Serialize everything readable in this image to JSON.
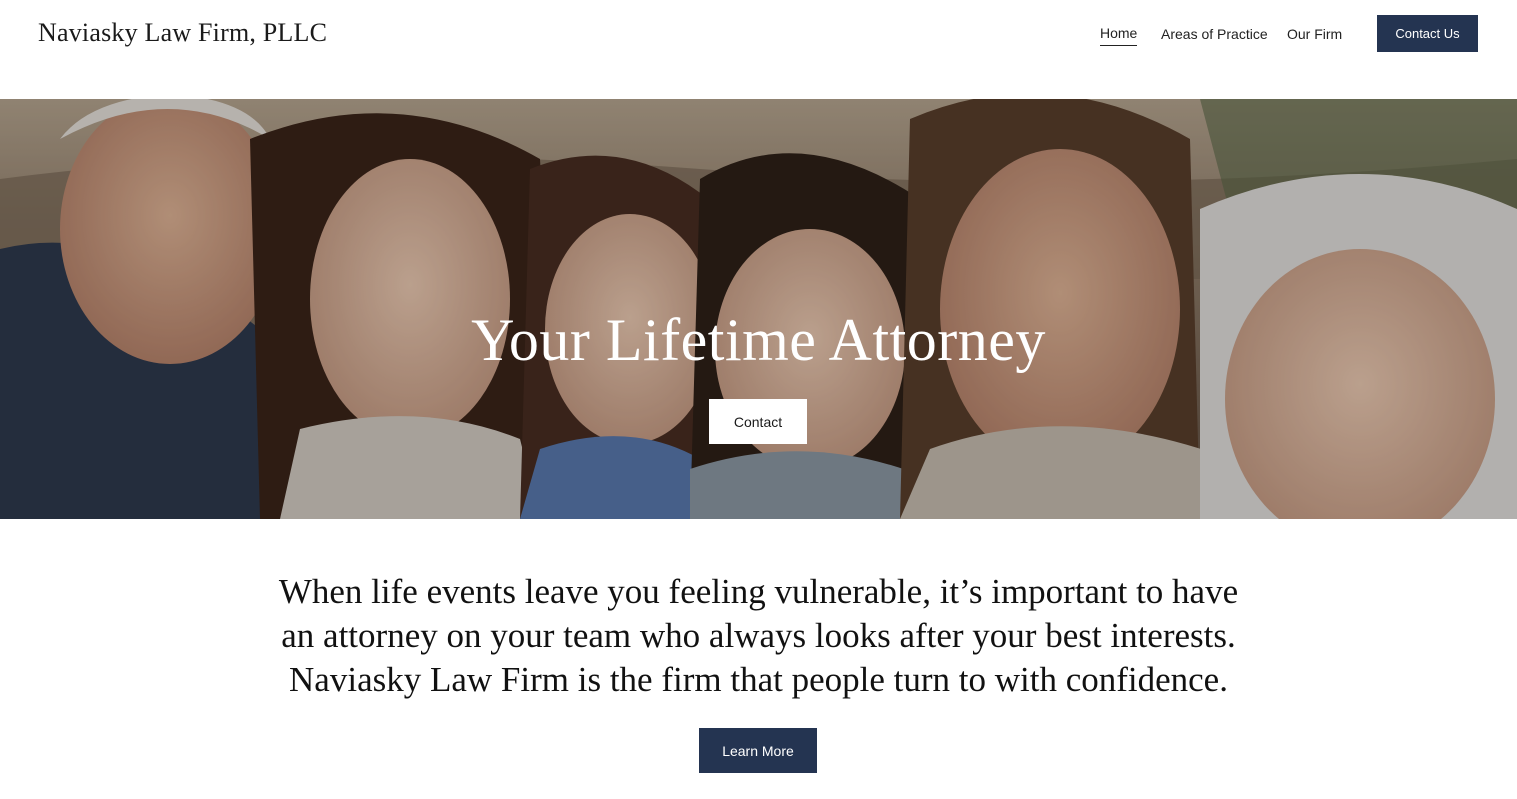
{
  "header": {
    "logo": "Naviasky Law Firm, PLLC",
    "nav": [
      {
        "label": "Home"
      },
      {
        "label": "Areas of Practice"
      },
      {
        "label": "Our Firm"
      }
    ],
    "cta_label": "Contact Us"
  },
  "hero": {
    "title": "Your Lifetime Attorney",
    "button_label": "Contact",
    "image": "family-group-photo"
  },
  "intro": {
    "text": "When life events leave you feeling vulnerable, it’s important to have an attorney on your team who always looks after your best interests. Naviasky Law Firm is the firm that people turn to with confidence.",
    "button_label": "Learn More"
  },
  "colors": {
    "brand_navy": "#243451",
    "background": "#ffffff",
    "text": "#111111"
  }
}
